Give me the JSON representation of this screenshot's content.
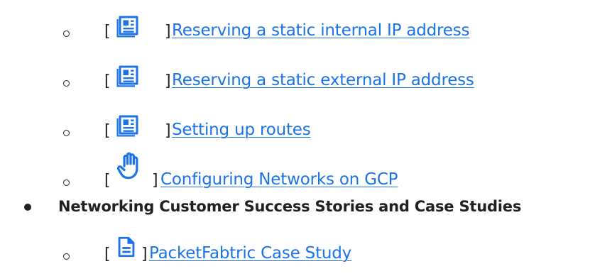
{
  "items": [
    {
      "icon": "newspaper-icon",
      "open_bracket": "[",
      "close_bracket": "]",
      "link": "Reserving a static internal IP address"
    },
    {
      "icon": "newspaper-icon",
      "open_bracket": "[",
      "close_bracket": "]",
      "link": "Reserving a static external IP address"
    },
    {
      "icon": "newspaper-icon",
      "open_bracket": "[",
      "close_bracket": "]",
      "link": "Setting up routes"
    },
    {
      "icon": "hand-icon",
      "open_bracket": "[",
      "close_bracket": "]",
      "link": "Configuring Networks on GCP"
    }
  ],
  "section": {
    "heading": "Networking Customer Success Stories and Case Studies",
    "items": [
      {
        "icon": "document-icon",
        "open_bracket": "[",
        "close_bracket": "]",
        "link": "PacketFabtric Case Study"
      }
    ]
  },
  "colors": {
    "link": "#1a73e8",
    "text": "#202124"
  }
}
